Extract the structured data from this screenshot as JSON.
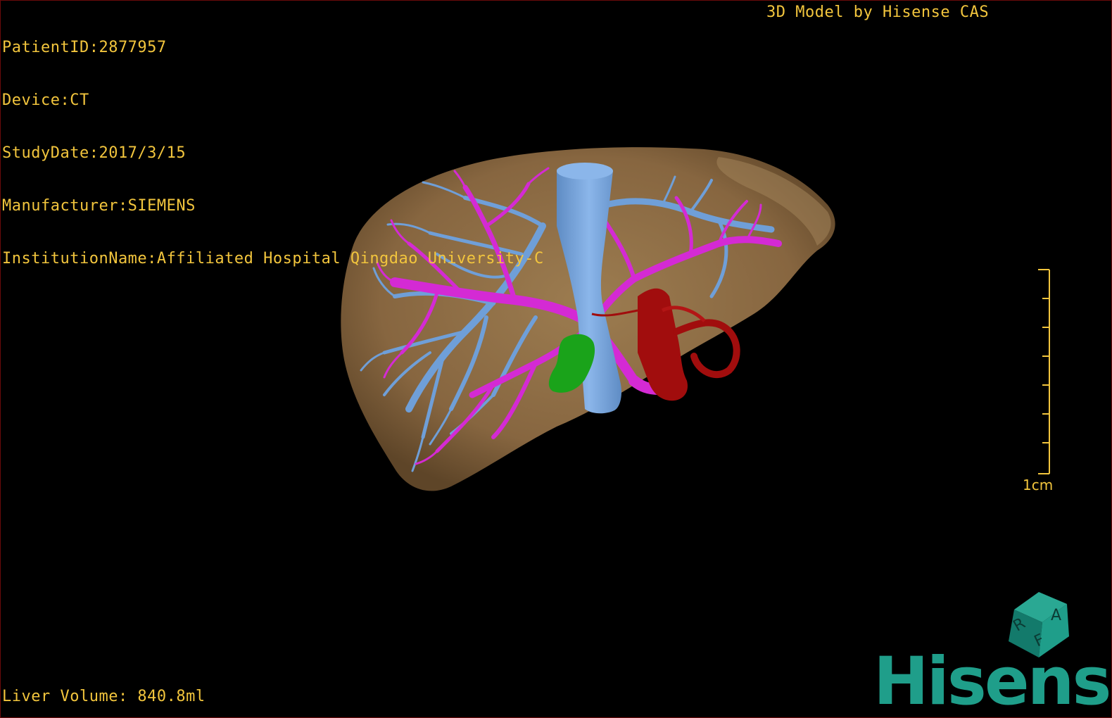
{
  "header": {
    "patient_id": "PatientID:2877957",
    "device": "Device:CT",
    "study_date": "StudyDate:2017/3/15",
    "manufacturer": "Manufacturer:SIEMENS",
    "institution": "InstitutionName:Affiliated Hospital Qingdao University-C"
  },
  "top_right_label": "3D Model by Hisense CAS",
  "footer": {
    "liver_volume": "Liver Volume: 840.8ml"
  },
  "scale_bar": {
    "label": "1cm"
  },
  "orientation_cube": {
    "faces": [
      "A",
      "R",
      "F"
    ],
    "color": "#1f9e8a"
  },
  "brand": {
    "name": "Hisense",
    "color": "#1f9e8a"
  },
  "model": {
    "structures": [
      {
        "name": "liver",
        "color": "#8a6a42"
      },
      {
        "name": "hepatic-vein",
        "color": "#6f9fd8"
      },
      {
        "name": "portal-vein",
        "color": "#d42ad4"
      },
      {
        "name": "artery",
        "color": "#a10d0d"
      },
      {
        "name": "gallbladder",
        "color": "#1aa31a"
      }
    ]
  },
  "colors": {
    "text": "#f2c53d",
    "background": "#000000"
  }
}
